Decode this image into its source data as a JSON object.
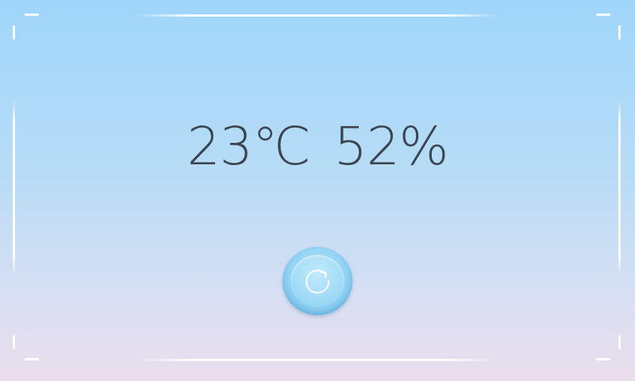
{
  "readout": {
    "temperature": "23℃",
    "humidity": "52%"
  },
  "refresh_button": {
    "icon": "refresh-icon"
  },
  "colors": {
    "background_top": "#9fd6fb",
    "background_bottom": "#eadeec",
    "text": "#3c4450",
    "button": "#8fd1f3",
    "frame": "#ffffff"
  }
}
